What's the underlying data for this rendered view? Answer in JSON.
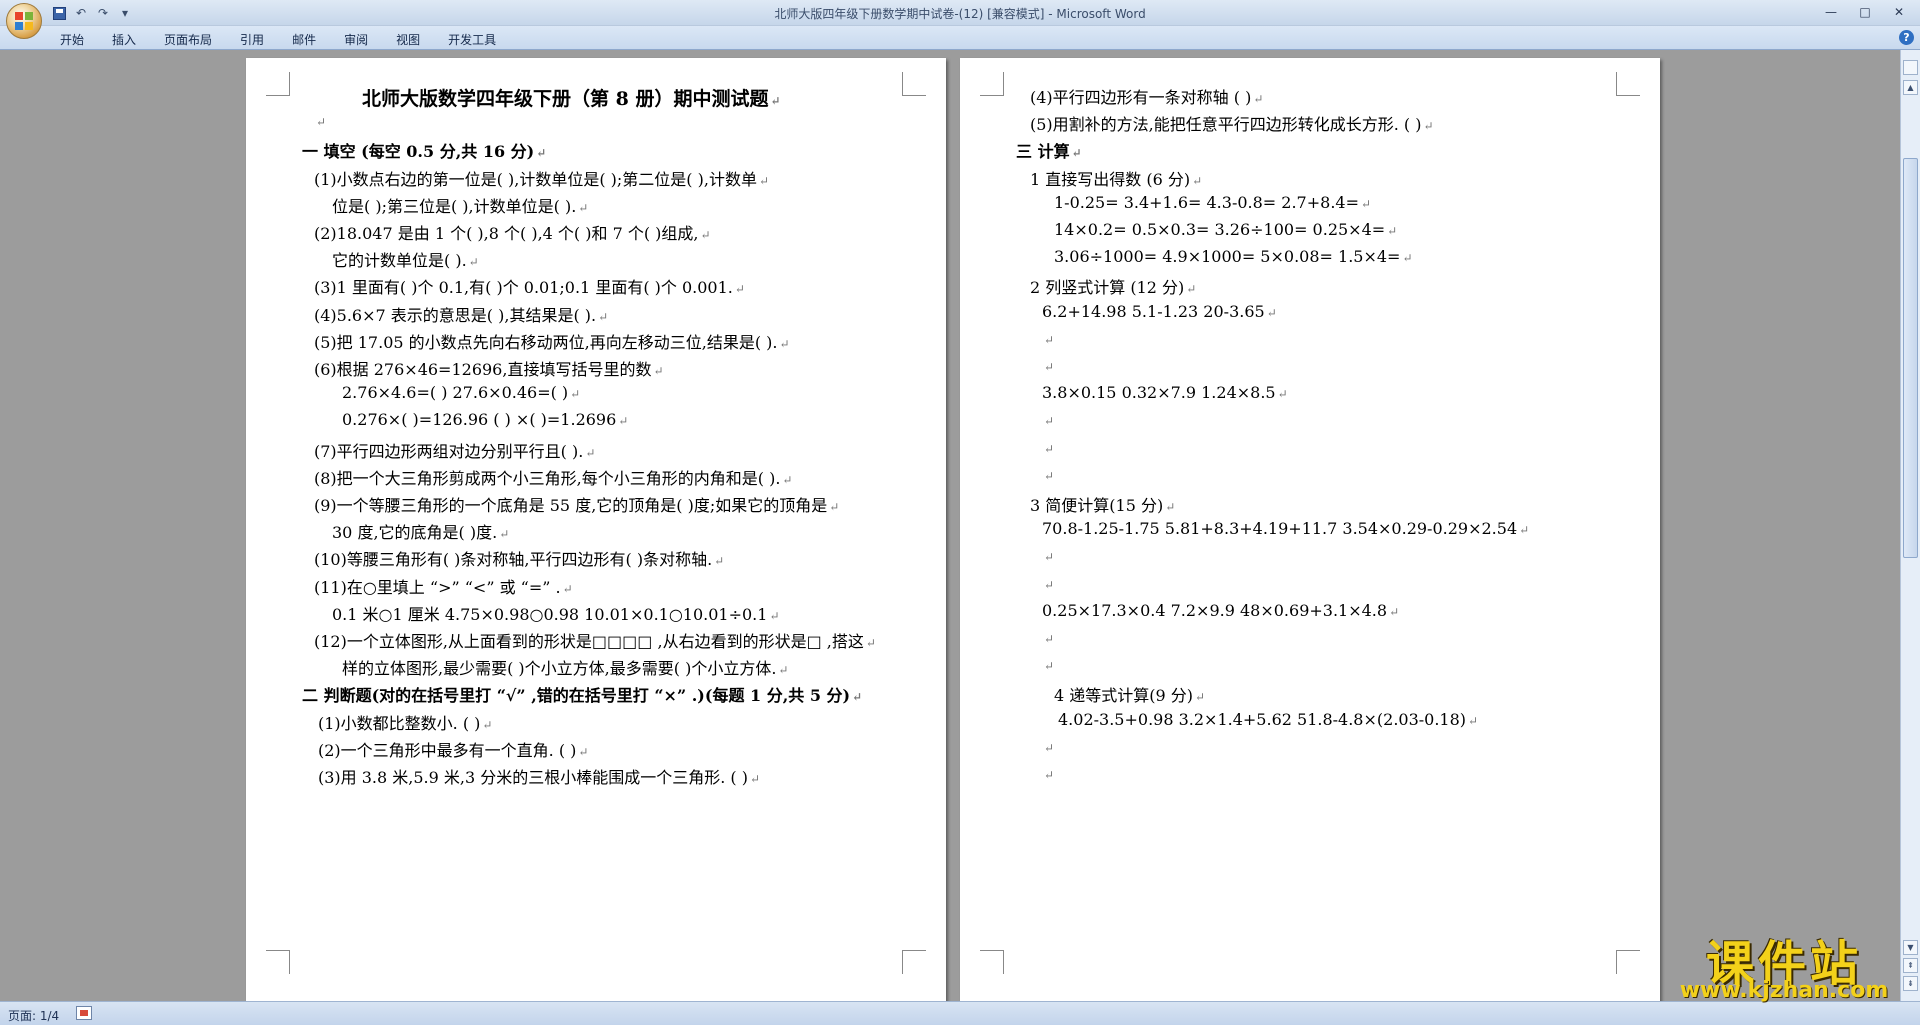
{
  "window": {
    "title": "北师大版四年级下册数学期中试卷-(12) [兼容模式] - Microsoft Word",
    "undo_glyph": "↶",
    "redo_glyph": "↷",
    "qat_more_glyph": "▾",
    "minimize_glyph": "—",
    "maximize_glyph": "□",
    "close_glyph": "✕"
  },
  "ribbon": {
    "tabs": [
      "开始",
      "插入",
      "页面布局",
      "引用",
      "邮件",
      "审阅",
      "视图",
      "开发工具"
    ],
    "help_glyph": "?"
  },
  "document": {
    "paragraph_mark": "↵",
    "left_page": [
      {
        "text": "北师大版数学四年级下册（第 8 册）期中测试题",
        "style": "title"
      },
      {
        "text": "",
        "style": "normal"
      },
      {
        "text": "一 填空  (每空 0.5 分,共 16 分)",
        "style": "section"
      },
      {
        "text": "(1)小数点右边的第一位是(        ),计数单位是(        );第二位是(        ),计数单",
        "style": "normal"
      },
      {
        "text": "位是(        );第三位是(        ),计数单位是(        ).",
        "style": "indent"
      },
      {
        "text": "(2)18.047 是由 1 个(        ),8 个(          ),4 个(          )和 7 个(          )组成,",
        "style": "normal"
      },
      {
        "text": "它的计数单位是(          ).",
        "style": "indent"
      },
      {
        "text": "(3)1 里面有(          )个 0.1,有(          )个 0.01;0.1 里面有(          )个 0.001.",
        "style": "normal"
      },
      {
        "text": "(4)5.6×7 表示的意思是(                                        ),其结果是(             ).",
        "style": "normal"
      },
      {
        "text": "(5)把 17.05 的小数点先向右移动两位,再向左移动三位,结果是(               ).",
        "style": "normal"
      },
      {
        "text": "(6)根据 276×46=12696,直接填写括号里的数",
        "style": "normal"
      },
      {
        "text": "2.76×4.6=(          )                           27.6×0.46=(          )",
        "style": "sub"
      },
      {
        "text": "0.276×(          )=126.96                   (          ) ×(          )=1.2696",
        "style": "sub"
      },
      {
        "text": "(7)平行四边形两组对边分别平行且(          ).",
        "style": "normal"
      },
      {
        "text": "(8)把一个大三角形剪成两个小三角形,每个小三角形的内角和是(             ).",
        "style": "normal"
      },
      {
        "text": "(9)一个等腰三角形的一个底角是 55 度,它的顶角是(          )度;如果它的顶角是",
        "style": "normal"
      },
      {
        "text": "30 度,它的底角是(          )度.",
        "style": "indent"
      },
      {
        "text": "(10)等腰三角形有(          )条对称轴,平行四边形有(          )条对称轴.",
        "style": "normal"
      },
      {
        "text": "(11)在○里填上 “>” “<” 或 “=” .",
        "style": "normal"
      },
      {
        "text": "0.1 米○1 厘米      4.75×0.98○0.98      10.01×0.1○10.01÷0.1",
        "style": "sub2"
      },
      {
        "text": "(12)一个立体图形,从上面看到的形状是□□□□ ,从右边看到的形状是□ ,搭这",
        "style": "normal"
      },
      {
        "text": "样的立体图形,最少需要(     )个小立方体,最多需要(     )个小立方体.",
        "style": "indent2"
      },
      {
        "text": "二 判断题(对的在括号里打 “√” ,错的在括号里打 “×” .)(每题 1 分,共 5 分)",
        "style": "section"
      },
      {
        "text": "(1)小数都比整数小.                                                            (          )",
        "style": "normal2"
      },
      {
        "text": "(2)一个三角形中最多有一个直角.                                            (          )",
        "style": "normal2"
      },
      {
        "text": "(3)用 3.8 米,5.9 米,3 分米的三根小棒能围成一个三角形.            (          )",
        "style": "normal2"
      }
    ],
    "right_page": [
      {
        "text": "(4)平行四边形有一条对称轴                                                          (          )",
        "style": "normal"
      },
      {
        "text": "(5)用割补的方法,能把任意平行四边形转化成长方形.                     (          )",
        "style": "normal"
      },
      {
        "text": "三 计算",
        "style": "section"
      },
      {
        "text": "1 直接写出得数 (6 分)",
        "style": "normal"
      },
      {
        "text": "1-0.25=            3.4+1.6=            4.3-0.8=            2.7+8.4=",
        "style": "sub"
      },
      {
        "text": "14×0.2=            0.5×0.3=            3.26÷100=          0.25×4=",
        "style": "sub"
      },
      {
        "text": "3.06÷1000=        4.9×1000=          5×0.08=            1.5×4=",
        "style": "sub"
      },
      {
        "text": "2 列竖式计算 (12 分)",
        "style": "normal"
      },
      {
        "text": "6.2+14.98                    5.1-1.23                       20-3.65",
        "style": "sub2"
      },
      {
        "text": "",
        "style": "sub2"
      },
      {
        "text": "",
        "style": "sub2"
      },
      {
        "text": "3.8×0.15                  0.32×7.9                      1.24×8.5",
        "style": "sub2"
      },
      {
        "text": "",
        "style": "sub2"
      },
      {
        "text": "",
        "style": "sub2"
      },
      {
        "text": "",
        "style": "sub2"
      },
      {
        "text": "3 简便计算(15 分)",
        "style": "normal"
      },
      {
        "text": "70.8-1.25-1.75           5.81+8.3+4.19+11.7         3.54×0.29-0.29×2.54",
        "style": "sub2"
      },
      {
        "text": "",
        "style": "sub2"
      },
      {
        "text": "",
        "style": "sub2"
      },
      {
        "text": "0.25×17.3×0.4            7.2×9.9                   48×0.69+3.1×4.8",
        "style": "sub2"
      },
      {
        "text": "",
        "style": "sub2"
      },
      {
        "text": "",
        "style": "sub2"
      },
      {
        "text": "4 递等式计算(9 分)",
        "style": "sub"
      },
      {
        "text": "4.02-3.5+0.98             3.2×1.4+5.62              51.8-4.8×(2.03-0.18)",
        "style": "sub3"
      },
      {
        "text": "",
        "style": "sub2"
      },
      {
        "text": "",
        "style": "sub2"
      }
    ]
  },
  "scrollbar": {
    "up_glyph": "▲",
    "down_glyph": "▼",
    "prev_glyph": "⇞",
    "next_glyph": "⇟"
  },
  "status": {
    "page": "页面: 1/4"
  },
  "watermark": {
    "text": "课件站",
    "url": "www.kjzhan.com"
  }
}
